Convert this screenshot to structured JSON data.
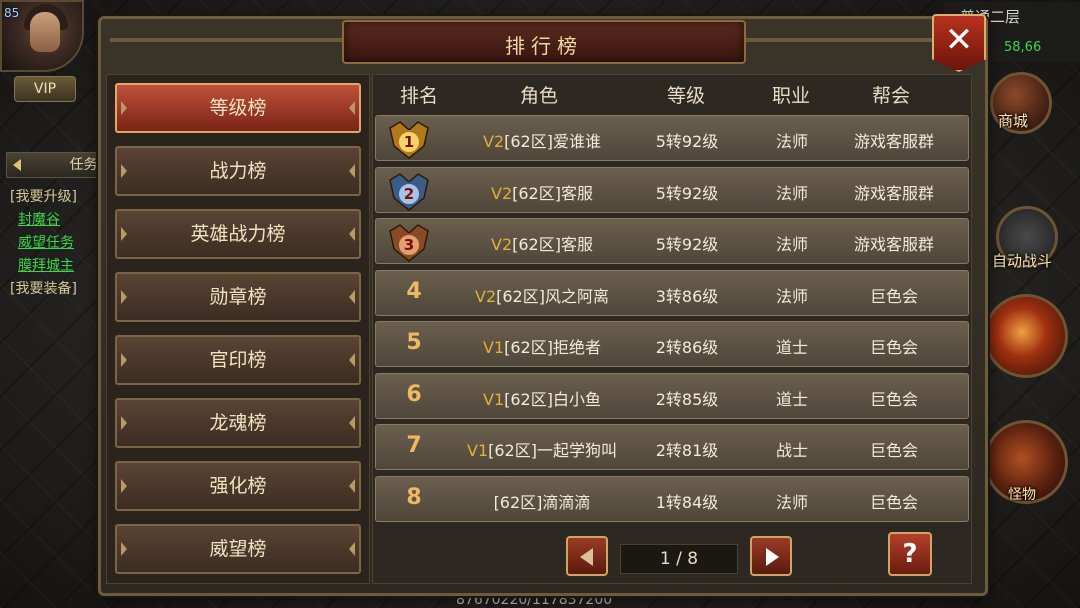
{
  "hud": {
    "level": "85",
    "vip": "VIP",
    "task_tab": "任务",
    "tasks": [
      {
        "text": "[我要升级]",
        "type": "header"
      },
      {
        "text": "封魔谷",
        "type": "link"
      },
      {
        "text": "威望任务",
        "type": "link"
      },
      {
        "text": "膜拜城主",
        "type": "link"
      },
      {
        "text": "[我要装备]",
        "type": "header"
      }
    ],
    "map_name": "普通二层",
    "coords": "58,66",
    "shop_label": "商城",
    "auto_battle_label": "自动战斗",
    "monster_label": "怪物",
    "exp_text": "87670220/117837200"
  },
  "panel": {
    "title": "排行榜",
    "menu": [
      {
        "label": "等级榜",
        "active": true
      },
      {
        "label": "战力榜",
        "active": false
      },
      {
        "label": "英雄战力榜",
        "active": false
      },
      {
        "label": "勋章榜",
        "active": false
      },
      {
        "label": "官印榜",
        "active": false
      },
      {
        "label": "龙魂榜",
        "active": false
      },
      {
        "label": "强化榜",
        "active": false
      },
      {
        "label": "威望榜",
        "active": false
      }
    ],
    "columns": [
      "排名",
      "角色",
      "等级",
      "职业",
      "帮会"
    ],
    "rows": [
      {
        "rank": "1",
        "vip": "V2",
        "name": "[62区]爱谁谁",
        "level": "5转92级",
        "job": "法师",
        "guild": "游戏客服群",
        "medal": "gold"
      },
      {
        "rank": "2",
        "vip": "V2",
        "name": "[62区]客服",
        "level": "5转92级",
        "job": "法师",
        "guild": "游戏客服群",
        "medal": "silver"
      },
      {
        "rank": "3",
        "vip": "V2",
        "name": "[62区]客服",
        "level": "5转92级",
        "job": "法师",
        "guild": "游戏客服群",
        "medal": "bronze"
      },
      {
        "rank": "4",
        "vip": "V2",
        "name": "[62区]风之阿离",
        "level": "3转86级",
        "job": "法师",
        "guild": "巨色会"
      },
      {
        "rank": "5",
        "vip": "V1",
        "name": "[62区]拒绝者",
        "level": "2转86级",
        "job": "道士",
        "guild": "巨色会"
      },
      {
        "rank": "6",
        "vip": "V1",
        "name": "[62区]白小鱼",
        "level": "2转85级",
        "job": "道士",
        "guild": "巨色会"
      },
      {
        "rank": "7",
        "vip": "V1",
        "name": "[62区]一起学狗叫",
        "level": "2转81级",
        "job": "战士",
        "guild": "巨色会"
      },
      {
        "rank": "8",
        "vip": "",
        "name": "[62区]滴滴滴",
        "level": "1转84级",
        "job": "法师",
        "guild": "巨色会"
      }
    ],
    "page": "1 / 8",
    "help": "?"
  },
  "colors": {
    "accent_red": "#b8321e",
    "gold": "#e0b03a",
    "link_green": "#3bd64a"
  }
}
